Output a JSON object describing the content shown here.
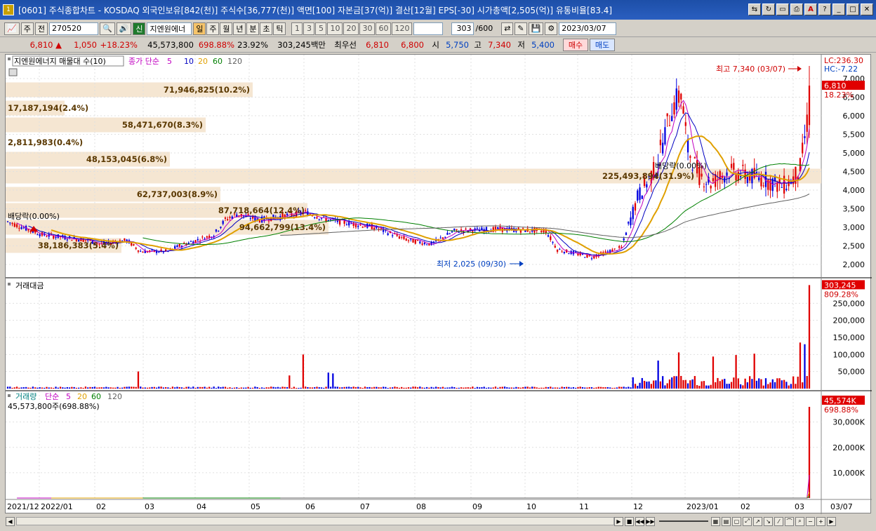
{
  "window": {
    "title": "[0601] 주식종합차트 - KOSDAQ 외국인보유[842(천)] 주식수[36,777(천)] 액면[100] 자본금[37(억)] 결산[12월] EPS[-30] 시가총액[2,505(억)] 유통비율[83.4]",
    "app_icon": "1"
  },
  "toolbar": {
    "market": "주",
    "prev": "전",
    "code": "270520",
    "name": "지엔원에너",
    "periods": [
      "일",
      "주",
      "월",
      "년",
      "분",
      "초",
      "틱"
    ],
    "period_active": "일",
    "nums": [
      "1",
      "3",
      "5",
      "10",
      "20",
      "30",
      "60",
      "120"
    ],
    "count": "303",
    "count_total": "/600",
    "date": "2023/03/07"
  },
  "quote": {
    "price": "6,810",
    "change": "1,050",
    "change_pct": "+18.23%",
    "volume": "45,573,800",
    "vol_ratio": "698.88%",
    "turnover": "23.92%",
    "amount": "303,245백만",
    "best_label": "최우선",
    "ask": "6,810",
    "bid": "6,800",
    "open_label": "시",
    "open": "5,750",
    "high_label": "고",
    "high": "7,340",
    "low_label": "저",
    "low": "5,400",
    "buy": "매수",
    "sell": "매도"
  },
  "panel_price": {
    "stock_label": "지엔원에너지 매물대 수(10)",
    "ma_label": "종가 단순",
    "ma_periods": [
      "5",
      "10",
      "20",
      "60",
      "120"
    ],
    "lc": "LC:236.30",
    "hc": "HC:-7.22",
    "last": "6,810",
    "last_pct": "18.23%",
    "high_note": "최고 7,340 (03/07)",
    "low_note": "최저 2,025 (09/30)",
    "div1": "배당락(0.00%)",
    "div2": "배당락(0.00%)",
    "yticks": [
      "7,000",
      "6,500",
      "6,000",
      "5,500",
      "5,000",
      "4,500",
      "4,000",
      "3,500",
      "3,000",
      "2,500",
      "2,000"
    ],
    "vp": [
      "71,946,825(10.2%)",
      "17,187,194(2.4%)",
      "58,471,670(8.3%)",
      "2,811,983(0.4%)",
      "48,153,045(6.8%)",
      "225,493,894(31.9%)",
      "62,737,003(8.9%)",
      "87,718,664(12.4%)",
      "94,662,799(13.4%)",
      "38,186,383(5.4%)"
    ]
  },
  "panel_amount": {
    "label": "거래대금",
    "last": "303,245",
    "last_pct": "809.28%",
    "yticks": [
      "250,000",
      "200,000",
      "150,000",
      "100,000",
      "50,000"
    ]
  },
  "panel_volume": {
    "label": "거래량",
    "ma_label": "단순",
    "ma_periods": [
      "5",
      "20",
      "60",
      "120"
    ],
    "info": "45,573,800주(698.88%)",
    "last": "45,574K",
    "last_pct": "698.88%",
    "yticks": [
      "30,000K",
      "20,000K",
      "10,000K"
    ]
  },
  "xaxis": [
    "2021/12",
    "2022/01",
    "02",
    "03",
    "04",
    "05",
    "06",
    "07",
    "08",
    "09",
    "10",
    "11",
    "12",
    "2023/01",
    "02",
    "03",
    "03/07"
  ],
  "colors": {
    "up": "#e00000",
    "down": "#0000e0",
    "ma5": "#c000c0",
    "ma10": "#0000c0",
    "ma20": "#e0a000",
    "ma60": "#008000",
    "ma120": "#606060",
    "vp": "#f5e6d2"
  }
}
